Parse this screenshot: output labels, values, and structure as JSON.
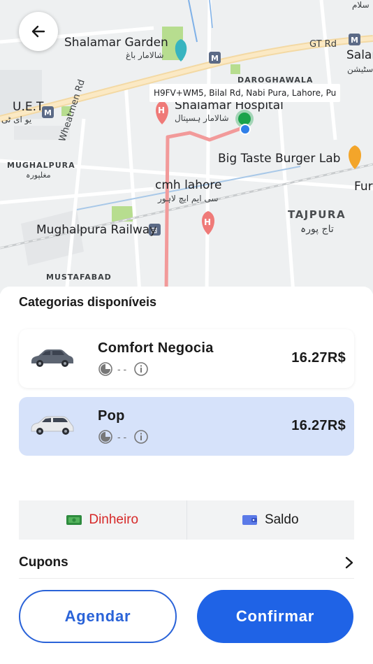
{
  "map": {
    "address_chip": "H9FV+WM5, Bilal Rd, Nabi Pura, Lahore, Pu",
    "labels": {
      "shalamar_garden": "Shalamar Garden",
      "shalamar_garden_urdu": "شالامار باغ",
      "gt_rd": "GT Rd",
      "salar": "Salar",
      "salar_urdu": "سٹیشن",
      "islam_urdu": "سلام",
      "daroghawala": "DAROGHAWALA",
      "uet": "U.E.T",
      "uet_urdu": "یو ای ٹی",
      "shalamar_hospital": "Shalamar Hospital",
      "shalamar_hospital_urdu": "شالامار ہسپتال",
      "wheatmen_rd": "Wheatmen Rd",
      "mughalpura": "MUGHALPURA",
      "mughalpura_urdu": "مغلپورہ",
      "big_taste": "Big Taste Burger Lab",
      "cmh": "cmh lahore",
      "cmh_urdu": "سی ایم ایچ لاہور",
      "fur": "Fur",
      "tajpura": "TAJPURA",
      "tajpura_urdu": "تاج پورہ",
      "railway": "Mughalpura Railway",
      "mustafabad": "MUSTAFABAD"
    }
  },
  "sheet": {
    "title": "Categorias disponíveis",
    "categories": [
      {
        "name": "Comfort Negocia",
        "eta": "- -",
        "price": "16.27R$",
        "selected": false
      },
      {
        "name": "Pop",
        "eta": "- -",
        "price": "16.27R$",
        "selected": true
      }
    ],
    "payment": {
      "cash_label": "Dinheiro",
      "balance_label": "Saldo"
    },
    "coupons_label": "Cupons",
    "schedule_label": "Agendar",
    "confirm_label": "Confirmar"
  },
  "colors": {
    "accent": "#1f63e6",
    "selected_card": "#d6e2fa",
    "cash_text": "#d62828",
    "route": "#f29a9a",
    "pickup": "#1aa34a"
  }
}
